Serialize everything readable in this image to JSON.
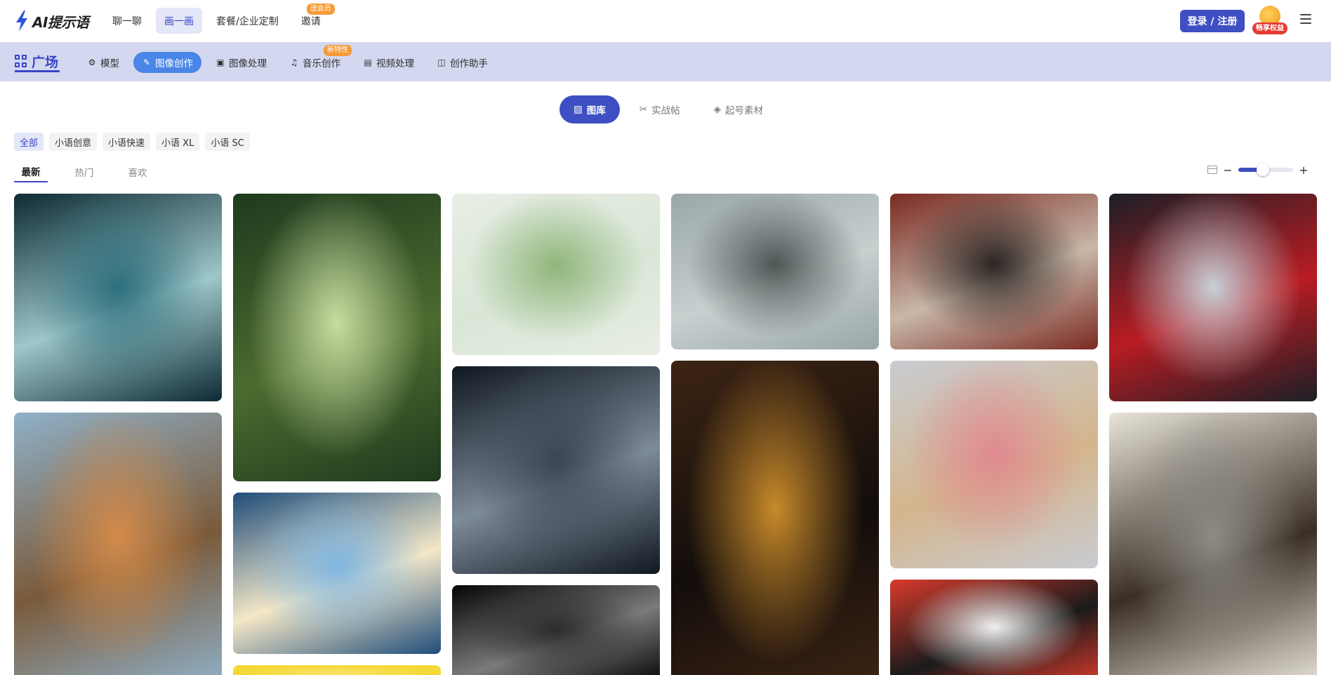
{
  "header": {
    "logo_text": "AI提示语",
    "nav": [
      {
        "label": "聊一聊",
        "active": false,
        "badge": ""
      },
      {
        "label": "画一画",
        "active": true,
        "badge": ""
      },
      {
        "label": "套餐/企业定制",
        "active": false,
        "badge": ""
      },
      {
        "label": "邀请",
        "active": false,
        "badge": "送会员"
      }
    ],
    "login_label": "登录 / 注册",
    "vip_label": "畅享权益"
  },
  "subnav": {
    "square_label": "广场",
    "items": [
      {
        "label": "模型",
        "icon": "model-icon",
        "active": false,
        "badge": ""
      },
      {
        "label": "图像创作",
        "icon": "image-create-icon",
        "active": true,
        "badge": ""
      },
      {
        "label": "图像处理",
        "icon": "image-edit-icon",
        "active": false,
        "badge": ""
      },
      {
        "label": "音乐创作",
        "icon": "music-icon",
        "active": false,
        "badge": "新特性"
      },
      {
        "label": "视频处理",
        "icon": "video-icon",
        "active": false,
        "badge": ""
      },
      {
        "label": "创作助手",
        "icon": "assistant-icon",
        "active": false,
        "badge": ""
      }
    ]
  },
  "library_tabs": [
    {
      "label": "图库",
      "icon": "gallery-icon",
      "active": true
    },
    {
      "label": "实战帖",
      "icon": "tools-icon",
      "active": false
    },
    {
      "label": "起号素材",
      "icon": "layers-icon",
      "active": false
    }
  ],
  "filters": [
    {
      "label": "全部",
      "active": true
    },
    {
      "label": "小语创意",
      "active": false
    },
    {
      "label": "小语快速",
      "active": false
    },
    {
      "label": "小语 XL",
      "active": false
    },
    {
      "label": "小语 SC",
      "active": false
    }
  ],
  "sort_tabs": [
    {
      "label": "最新",
      "active": true
    },
    {
      "label": "热门",
      "active": false
    },
    {
      "label": "喜欢",
      "active": false
    }
  ],
  "zoom": {
    "minus": "−",
    "plus": "+",
    "level": 0.45
  },
  "gallery": [
    {
      "subject": "underwater-girl",
      "colors": [
        "#0d2a33",
        "#2d6f7d",
        "#9ec7c9"
      ]
    },
    {
      "subject": "tiger-warrior",
      "colors": [
        "#8fb1c9",
        "#d38b4a",
        "#7a5a3a"
      ]
    },
    {
      "subject": "bottle-flowers",
      "colors": [
        "#1e3a1e",
        "#c8dca0",
        "#4c6b2f"
      ]
    },
    {
      "subject": "dove-boat",
      "colors": [
        "#1f4d7a",
        "#7fb6e0",
        "#f4e7c7"
      ]
    },
    {
      "subject": "yellow-card",
      "colors": [
        "#f5d93a",
        "#f9e36b",
        "#f5d93a"
      ]
    },
    {
      "subject": "lotus-pond",
      "colors": [
        "#e8eee5",
        "#8fb67a",
        "#d9e6d6"
      ]
    },
    {
      "subject": "scared-girl",
      "colors": [
        "#101820",
        "#3a4654",
        "#7d8a99"
      ]
    },
    {
      "subject": "bw-portrait",
      "colors": [
        "#050505",
        "#2c2c2c",
        "#7a7a7a"
      ]
    },
    {
      "subject": "armored-warrior",
      "colors": [
        "#9aa6a8",
        "#4e5656",
        "#c7d0cf"
      ]
    },
    {
      "subject": "woman-doorway",
      "colors": [
        "#3d2414",
        "#c88a2a",
        "#120d0b"
      ]
    },
    {
      "subject": "panda-warrior",
      "colors": [
        "#7a2a22",
        "#2b2623",
        "#c8b7a8"
      ]
    },
    {
      "subject": "roses-vase",
      "colors": [
        "#c9ccd2",
        "#e08a90",
        "#d4b58c"
      ]
    },
    {
      "subject": "ink-portrait",
      "colors": [
        "#d83a2c",
        "#efefef",
        "#1a1a1a"
      ]
    },
    {
      "subject": "snow-berries",
      "colors": [
        "#1c1f26",
        "#c8cfd7",
        "#b81c22"
      ]
    },
    {
      "subject": "eagle-flight",
      "colors": [
        "#e8e4da",
        "#8d8b85",
        "#3a2f24"
      ]
    }
  ]
}
